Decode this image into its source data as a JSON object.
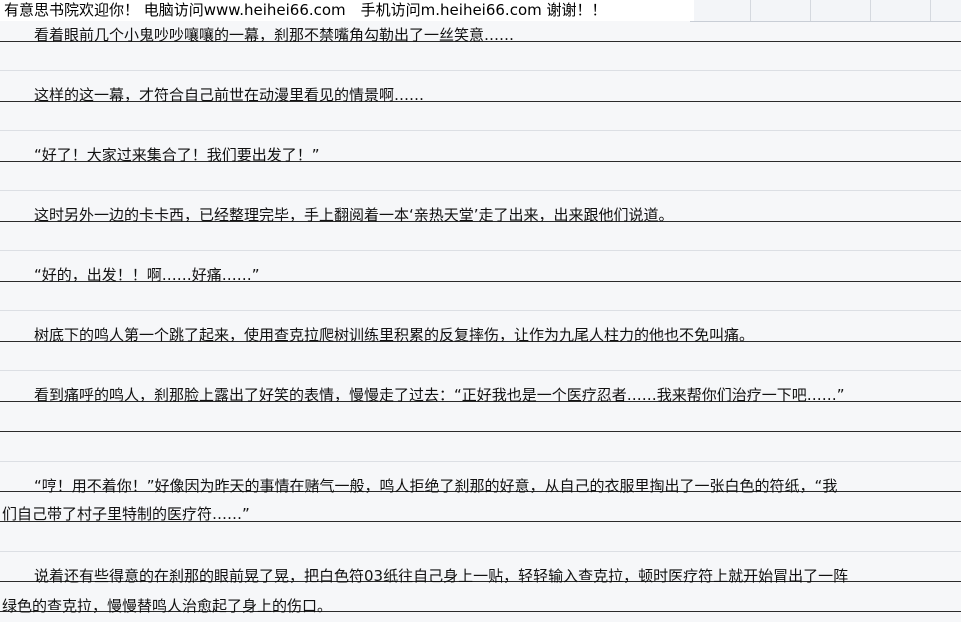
{
  "banner": "有意思书院欢迎你！ 电脑访问www.heihei66.com　手机访问m.heihei66.com 谢谢！！",
  "paragraphs": [
    "看着眼前几个小鬼吵吵嚷嚷的一幕，刹那不禁嘴角勾勒出了一丝笑意……",
    "这样的这一幕，才符合自己前世在动漫里看见的情景啊……",
    "“好了！大家过来集合了！我们要出发了！”",
    "这时另外一边的卡卡西，已经整理完毕，手上翻阅着一本‘亲热天堂’走了出来，出来跟他们说道。",
    "“好的，出发！！啊……好痛……”",
    "树底下的鸣人第一个跳了起来，使用查克拉爬树训练里积累的反复摔伤，让作为九尾人柱力的他也不免叫痛。",
    "看到痛呼的鸣人，刹那脸上露出了好笑的表情，慢慢走了过去：“正好我也是一个医疗忍者……我来帮你们治疗一下吧……”",
    "“哼！用不着你！”好像因为昨天的事情在赌气一般，鸣人拒绝了刹那的好意，从自己的衣服里掏出了一张白色的符纸，“我",
    "们自己带了村子里特制的医疗符……”",
    "说着还有些得意的在刹那的眼前晃了晃，把白色符03纸往自己身上一贴，轻轻输入查克拉，顿时医疗符上就开始冒出了一阵",
    "绿色的查克拉，慢慢替鸣人治愈起了身上的伤口。"
  ]
}
